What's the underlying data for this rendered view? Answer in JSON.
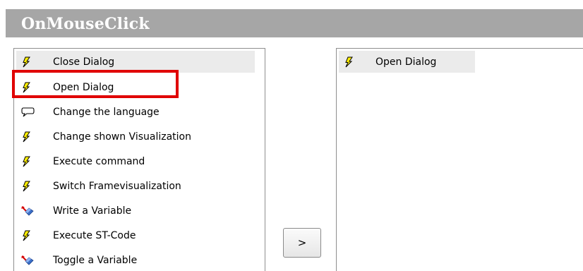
{
  "header": {
    "title": "OnMouseClick"
  },
  "left_list": {
    "items": [
      {
        "label": "Close Dialog",
        "icon": "lightning-icon",
        "selected": true
      },
      {
        "label": "Open Dialog",
        "icon": "lightning-icon",
        "selected": false
      },
      {
        "label": "Change the language",
        "icon": "speech-bubble-icon",
        "selected": false
      },
      {
        "label": "Change shown Visualization",
        "icon": "lightning-icon",
        "selected": false
      },
      {
        "label": "Execute command",
        "icon": "lightning-icon",
        "selected": false
      },
      {
        "label": "Switch Framevisualization",
        "icon": "lightning-icon",
        "selected": false
      },
      {
        "label": "Write a Variable",
        "icon": "write-variable-icon",
        "selected": false
      },
      {
        "label": "Execute ST-Code",
        "icon": "lightning-icon",
        "selected": false
      },
      {
        "label": "Toggle a Variable",
        "icon": "write-variable-icon",
        "selected": false
      }
    ]
  },
  "right_list": {
    "items": [
      {
        "label": "Open Dialog",
        "icon": "lightning-icon",
        "selected": true
      }
    ]
  },
  "buttons": {
    "move_right_label": ">"
  },
  "colors": {
    "header_bg": "#a6a6a6",
    "highlight": "#e00000",
    "selected_bg": "#ebebeb",
    "lightning": "#ffee00"
  }
}
